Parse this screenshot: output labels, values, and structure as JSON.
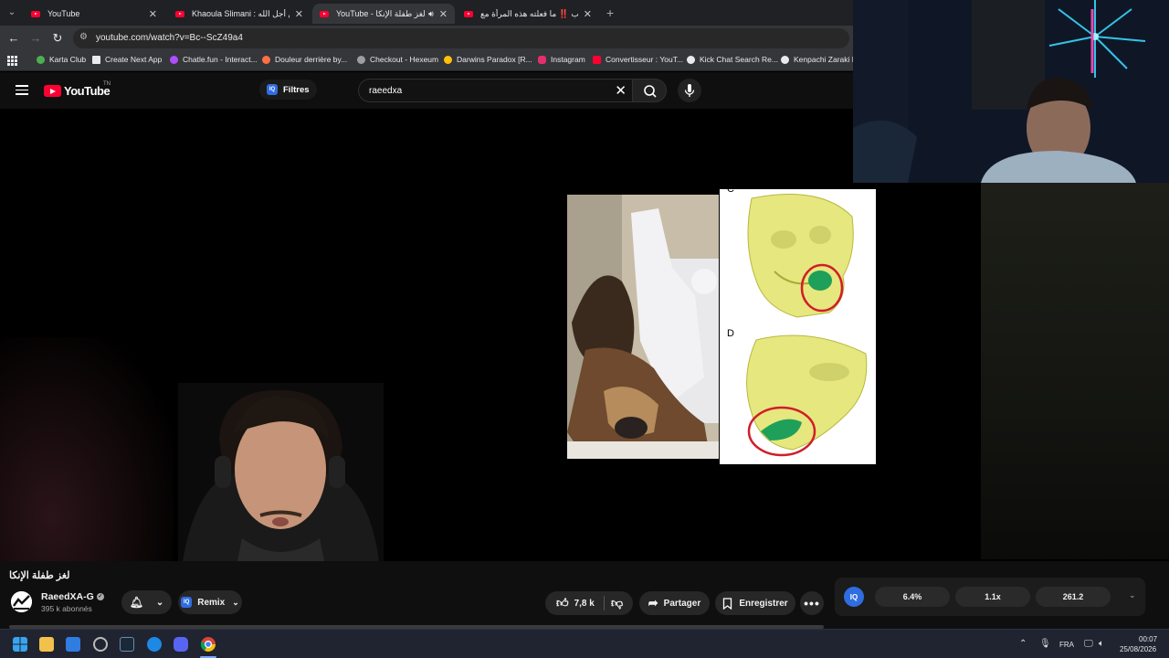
{
  "browser": {
    "tabs": [
      {
        "title": "YouTube",
        "active": false
      },
      {
        "title": "Khaoula Slimani : يء من أجل الله",
        "active": false
      },
      {
        "title": "YouTube - لغز طفلة الإنكا",
        "active": true
      },
      {
        "title": "عريب ‼️ ما فعلته هذه المرأة مع",
        "active": false
      }
    ],
    "url": "youtube.com/watch?v=Bc--ScZ49a4",
    "bookmarks": [
      {
        "label": "Karta Club",
        "color": "#4caf50"
      },
      {
        "label": "Create Next App",
        "color": "#e8eaed"
      },
      {
        "label": "Chatle.fun - Interact...",
        "color": "#b04dff"
      },
      {
        "label": "Douleur derrière by...",
        "color": "#ff7043"
      },
      {
        "label": "Checkout - Hexeum",
        "color": "#9e9e9e"
      },
      {
        "label": "Darwins Paradox [R...",
        "color": "#ffc107"
      },
      {
        "label": "Instagram",
        "color": "#e1306c"
      },
      {
        "label": "Convertisseur : YouT...",
        "color": "#ff0033"
      },
      {
        "label": "Kick Chat Search Re...",
        "color": "#e8eaed"
      },
      {
        "label": "Kenpachi Zaraki Bl",
        "color": "#e8eaed"
      }
    ]
  },
  "youtube": {
    "logo_text": "YouTube",
    "logo_suffix": "TN",
    "filters_label": "Filtres",
    "iq_badge": "IQ",
    "search_value": "raeedxa"
  },
  "video": {
    "figure_label_c": "C",
    "figure_label_d": "D"
  },
  "details": {
    "title": "لغز طفلة الإنكا",
    "channel_name": "RaeedXA-G",
    "subscribers": "395 k abonnés",
    "remix_label": "Remix",
    "likes": "7,8 k",
    "share_label": "Partager",
    "save_label": "Enregistrer"
  },
  "iq_stats": {
    "logo": "IQ",
    "values": [
      "6.4%",
      "1.1x",
      "261.2"
    ]
  },
  "taskbar": {
    "language": "FRA",
    "time": "00:07",
    "date": "25/08/2026"
  }
}
